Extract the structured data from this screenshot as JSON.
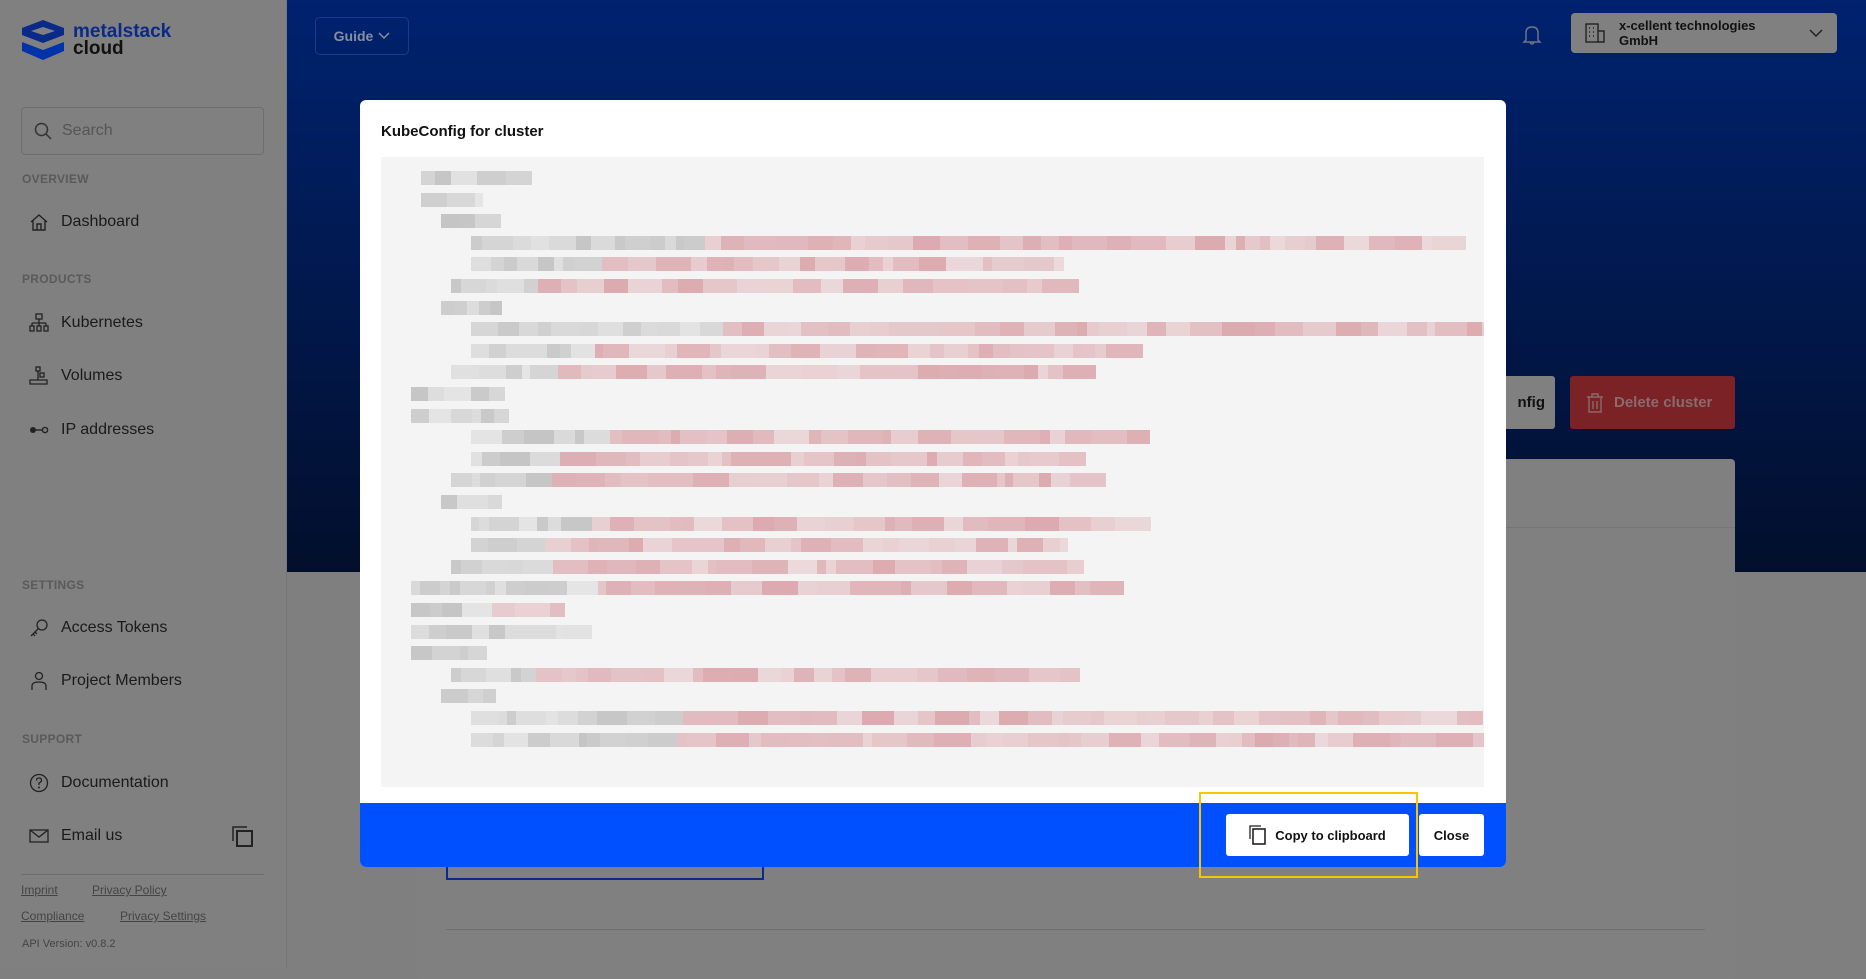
{
  "brand": {
    "line1": "metalstack",
    "line2": "cloud"
  },
  "search": {
    "placeholder": "Search"
  },
  "sidebar": {
    "sections": [
      {
        "label": "OVERVIEW",
        "items": [
          {
            "label": "Dashboard",
            "icon": "home-icon"
          }
        ]
      },
      {
        "label": "PRODUCTS",
        "items": [
          {
            "label": "Kubernetes",
            "icon": "network-icon"
          },
          {
            "label": "Volumes",
            "icon": "volumes-icon"
          },
          {
            "label": "IP addresses",
            "icon": "ip-icon"
          }
        ]
      },
      {
        "label": "SETTINGS",
        "items": [
          {
            "label": "Access Tokens",
            "icon": "key-icon"
          },
          {
            "label": "Project Members",
            "icon": "user-icon"
          }
        ]
      },
      {
        "label": "SUPPORT",
        "items": [
          {
            "label": "Documentation",
            "icon": "question-icon"
          },
          {
            "label": "Email us",
            "icon": "mail-icon"
          }
        ]
      }
    ],
    "footer_links": [
      "Imprint",
      "Privacy Policy",
      "Compliance",
      "Privacy Settings"
    ],
    "api_version": "API Version: v0.8.2"
  },
  "header": {
    "guide": "Guide",
    "org": "x-cellent technologies GmbH"
  },
  "page": {
    "config_button_partial": "nfig",
    "delete_button": "Delete cluster"
  },
  "modal": {
    "title": "KubeConfig for cluster",
    "copy_button": "Copy to clipboard",
    "close_button": "Close"
  },
  "colors": {
    "modal_footer": "#0050ff",
    "highlight": "#f7c600",
    "delete": "#7a2226",
    "header_top": "#00226f"
  }
}
